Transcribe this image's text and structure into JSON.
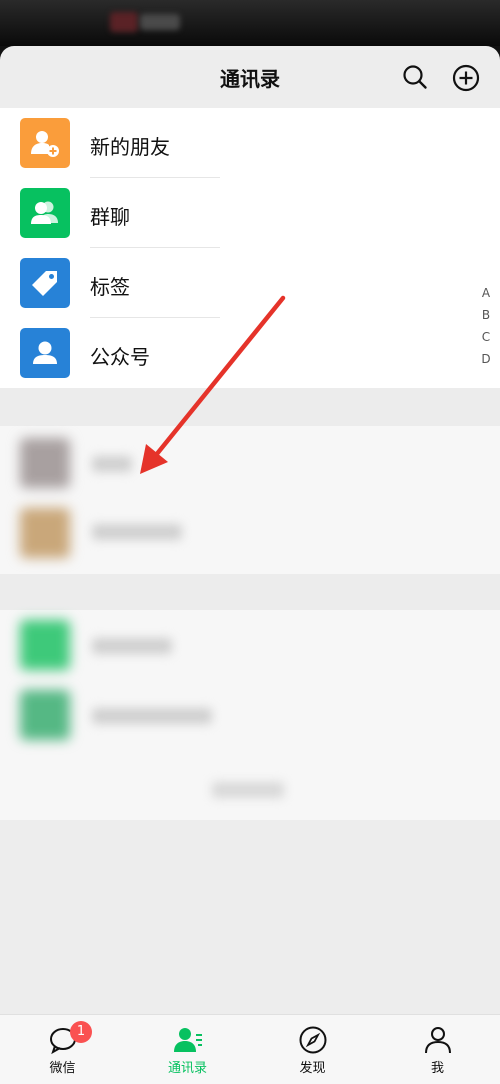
{
  "header": {
    "title": "通讯录",
    "search_icon": "search-icon",
    "add_icon": "plus-circle-icon"
  },
  "menu": [
    {
      "label": "新的朋友",
      "icon": "add-friend-icon",
      "color": "#fa9d3b"
    },
    {
      "label": "群聊",
      "icon": "group-icon",
      "color": "#07c160"
    },
    {
      "label": "标签",
      "icon": "tag-icon",
      "color": "#2782d7"
    },
    {
      "label": "公众号",
      "icon": "official-account-icon",
      "color": "#2782d7"
    }
  ],
  "index_letters": [
    "A",
    "B",
    "C",
    "D"
  ],
  "tabs": [
    {
      "label": "微信",
      "icon": "chat-bubble-icon",
      "badge": "1"
    },
    {
      "label": "通讯录",
      "icon": "contacts-icon",
      "active": true
    },
    {
      "label": "发现",
      "icon": "compass-icon"
    },
    {
      "label": "我",
      "icon": "person-icon"
    }
  ],
  "accent_color": "#07c160",
  "annotation_arrow_color": "#e5332a"
}
